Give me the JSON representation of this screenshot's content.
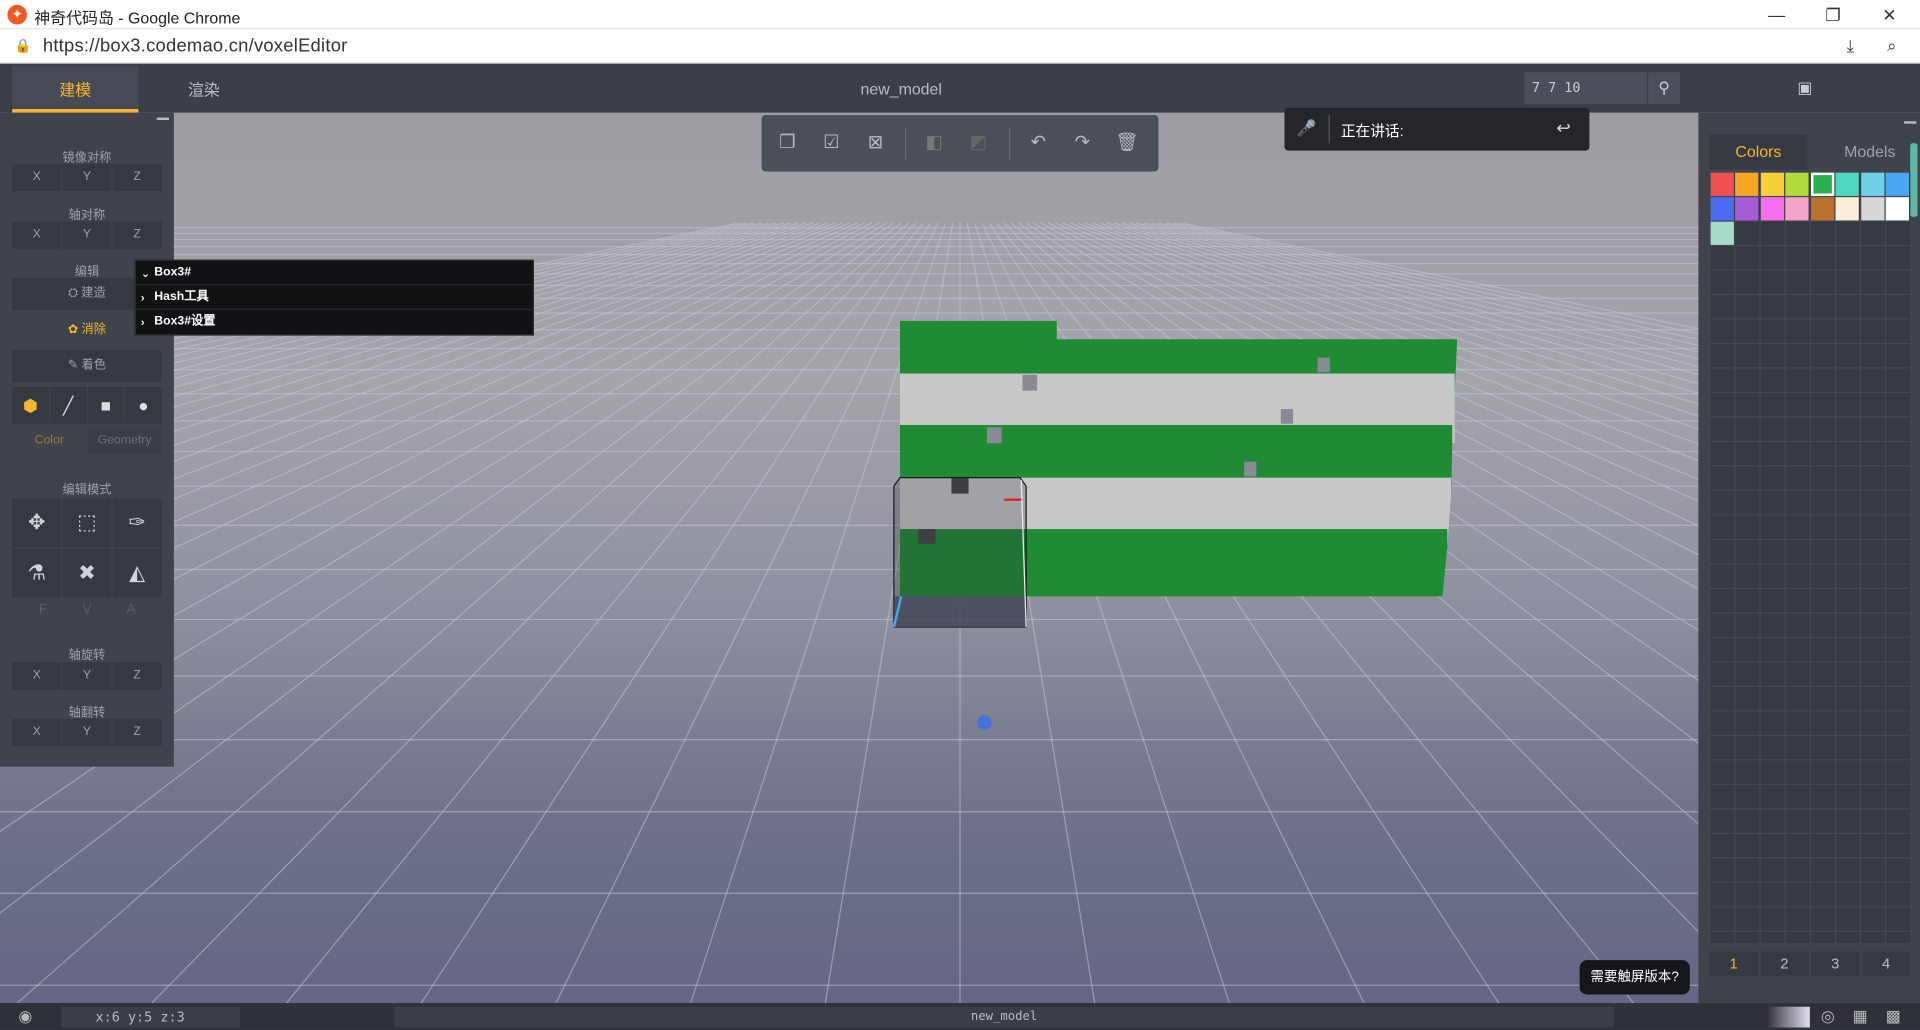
{
  "window": {
    "title": "神奇代码岛 - Google Chrome",
    "url": "https://box3.codemao.cn/voxelEditor",
    "minimize_icon": "minimize-icon",
    "maximize_icon": "restore-icon",
    "close_icon": "close-icon"
  },
  "topbar": {
    "tab_model": "建模",
    "tab_render": "渲染",
    "model_name": "new_model",
    "coord_value": "7 7 10"
  },
  "speaking": {
    "label": "正在讲话:"
  },
  "left_panel": {
    "mirror_title": "镜像对称",
    "axis_sym_title": "轴对称",
    "edit_title": "编辑",
    "build": "建造",
    "erase": "消除",
    "paint": "着色",
    "color": "Color",
    "geometry": "Geometry",
    "edit_mode_title": "编辑模式",
    "rotate_title": "轴旋转",
    "flip_title": "轴翻转",
    "f": "F",
    "v": "V",
    "a": "A",
    "x": "X",
    "y": "Y",
    "z": "Z"
  },
  "tree": {
    "items": [
      "Box3#",
      "Hash工具",
      "Box3#设置"
    ]
  },
  "right_panel": {
    "tab_colors": "Colors",
    "tab_models": "Models",
    "pages": [
      "1",
      "2",
      "3",
      "4"
    ],
    "palette": [
      "#f05050",
      "#f5a623",
      "#f8d03a",
      "#b3d93a",
      "#27b04b",
      "#4fd8c0",
      "#6fd0e8",
      "#4aa6f0",
      "#4a6cf0",
      "#a45cd8",
      "#f76ff0",
      "#f5a4c8",
      "#b8722e",
      "#fbeed8",
      "#d8d8d8",
      "#ffffff",
      "#a6dcc8"
    ],
    "selected_index": 4
  },
  "touch_button": "需要触屏版本?",
  "bottombar": {
    "coords": "x:6 y:5 z:3",
    "name": "new_model"
  }
}
